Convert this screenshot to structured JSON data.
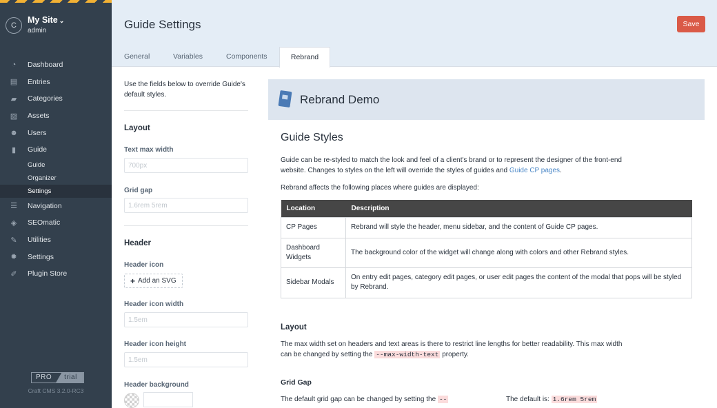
{
  "sidebar": {
    "site_initial": "C",
    "site_name": "My Site",
    "user": "admin",
    "nav": [
      {
        "label": "Dashboard",
        "icon": "dashboard-icon",
        "glyph": "◔"
      },
      {
        "label": "Entries",
        "icon": "entries-icon",
        "glyph": "▤"
      },
      {
        "label": "Categories",
        "icon": "categories-icon",
        "glyph": "▰"
      },
      {
        "label": "Assets",
        "icon": "assets-icon",
        "glyph": "▨"
      },
      {
        "label": "Users",
        "icon": "users-icon",
        "glyph": "☻"
      },
      {
        "label": "Guide",
        "icon": "guide-icon",
        "glyph": "▮"
      }
    ],
    "guide_sub": [
      "Guide",
      "Organizer",
      "Settings"
    ],
    "nav2": [
      {
        "label": "Navigation",
        "icon": "navigation-icon",
        "glyph": "☰"
      },
      {
        "label": "SEOmatic",
        "icon": "seomatic-icon",
        "glyph": "◈"
      },
      {
        "label": "Utilities",
        "icon": "wrench-icon",
        "glyph": "✎"
      },
      {
        "label": "Settings",
        "icon": "gear-icon",
        "glyph": "✹"
      },
      {
        "label": "Plugin Store",
        "icon": "plug-icon",
        "glyph": "✐"
      }
    ],
    "edition_pro": "PRO",
    "edition_trial": "trial",
    "version": "Craft CMS 3.2.0-RC3"
  },
  "header": {
    "title": "Guide Settings",
    "save_label": "Save"
  },
  "tabs": [
    "General",
    "Variables",
    "Components",
    "Rebrand"
  ],
  "left": {
    "intro": "Use the fields below to override Guide's default styles.",
    "layout_heading": "Layout",
    "text_max_width_label": "Text max width",
    "text_max_width_placeholder": "700px",
    "grid_gap_label": "Grid gap",
    "grid_gap_placeholder": "1.6rem 5rem",
    "header_heading": "Header",
    "header_icon_label": "Header icon",
    "add_svg_label": "Add an SVG",
    "header_icon_width_label": "Header icon width",
    "header_icon_width_placeholder": "1.5em",
    "header_icon_height_label": "Header icon height",
    "header_icon_height_placeholder": "1.5em",
    "header_background_label": "Header background"
  },
  "demo": {
    "title": "Rebrand Demo",
    "styles_heading": "Guide Styles",
    "p1_a": "Guide can be re-styled to match the look and feel of a client's brand or to represent the designer of the front-end website. Changes to styles on the left will override the styles of guides and ",
    "p1_link": "Guide CP pages",
    "p1_b": ".",
    "p2": "Rebrand affects the following places where guides are displayed:",
    "table": {
      "headers": [
        "Location",
        "Description"
      ],
      "rows": [
        [
          "CP Pages",
          "Rebrand will style the header, menu sidebar, and the content of Guide CP pages."
        ],
        [
          "Dashboard Widgets",
          "The background color of the widget will change along with colors and other Rebrand styles."
        ],
        [
          "Sidebar Modals",
          "On entry edit pages, category edit pages, or user edit pages the content of the modal that pops will be styled by Rebrand."
        ]
      ]
    },
    "layout_heading": "Layout",
    "layout_p_a": "The max width set on headers and text areas is there to restrict line lengths for better readability. This max width can be changed by setting the ",
    "layout_p_code": "--max-width-text",
    "layout_p_b": " property.",
    "grid_heading": "Grid Gap",
    "grid_p_a": "The default grid gap can be changed by setting the ",
    "grid_p_code": "--",
    "grid_default_a": "The default is: ",
    "grid_default_code": "1.6rem 5rem"
  }
}
